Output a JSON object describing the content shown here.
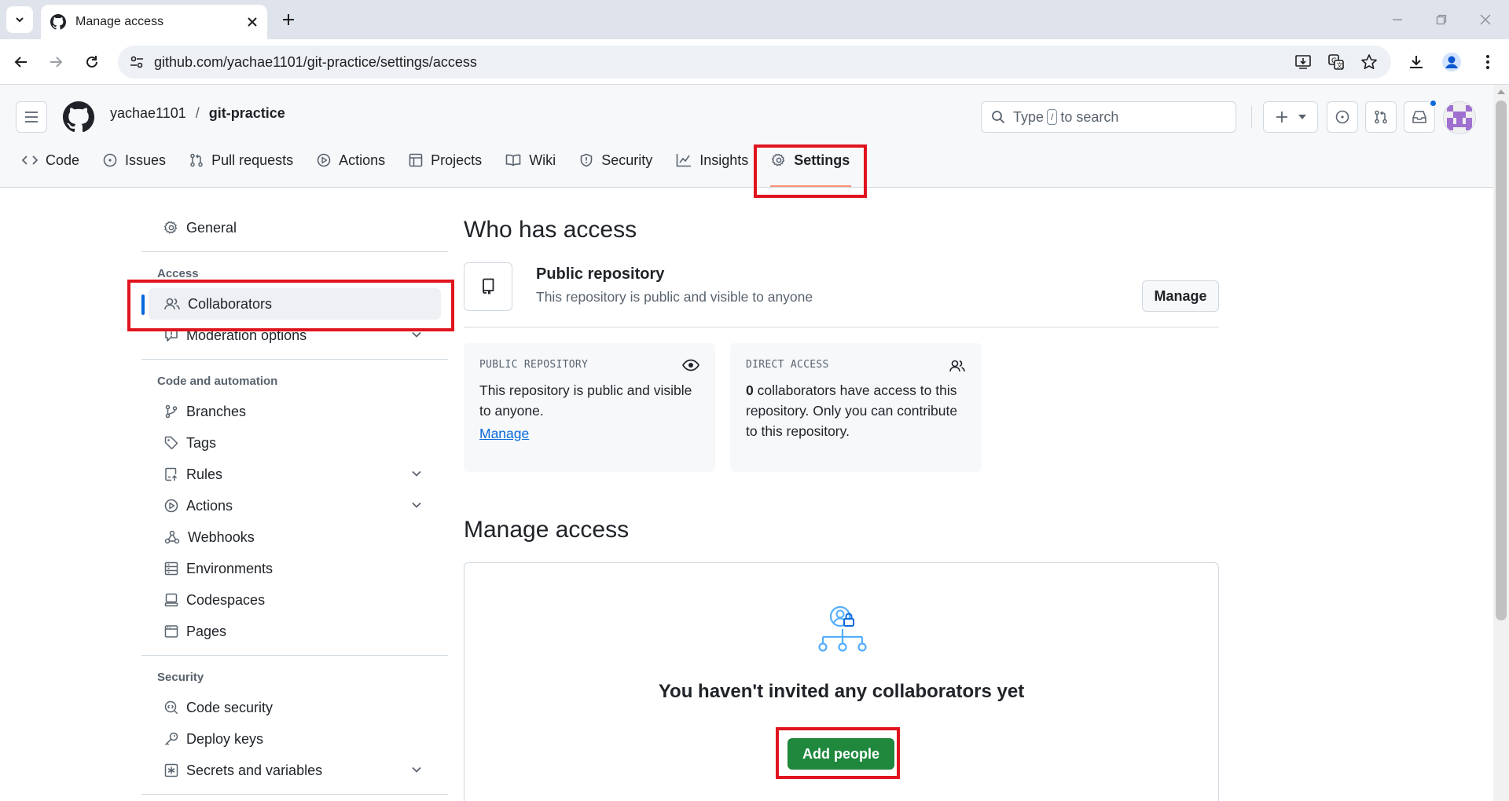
{
  "browser": {
    "tab_title": "Manage access",
    "url": "github.com/yachae1101/git-practice/settings/access"
  },
  "header": {
    "owner": "yachae1101",
    "separator": "/",
    "repo": "git-practice",
    "search_prefix": "Type",
    "search_key": "/",
    "search_suffix": "to search"
  },
  "repo_nav": [
    {
      "label": "Code",
      "icon": "code-icon"
    },
    {
      "label": "Issues",
      "icon": "issue-icon"
    },
    {
      "label": "Pull requests",
      "icon": "pull-request-icon"
    },
    {
      "label": "Actions",
      "icon": "play-icon"
    },
    {
      "label": "Projects",
      "icon": "table-icon"
    },
    {
      "label": "Wiki",
      "icon": "book-icon"
    },
    {
      "label": "Security",
      "icon": "shield-icon"
    },
    {
      "label": "Insights",
      "icon": "graph-icon"
    },
    {
      "label": "Settings",
      "icon": "gear-icon"
    }
  ],
  "sidebar": {
    "general": "General",
    "access_heading": "Access",
    "collaborators": "Collaborators",
    "moderation": "Moderation options",
    "code_heading": "Code and automation",
    "branches": "Branches",
    "tags": "Tags",
    "rules": "Rules",
    "actions": "Actions",
    "webhooks": "Webhooks",
    "environments": "Environments",
    "codespaces": "Codespaces",
    "pages": "Pages",
    "security_heading": "Security",
    "code_security": "Code security",
    "deploy_keys": "Deploy keys",
    "secrets": "Secrets and variables"
  },
  "main": {
    "who_title": "Who has access",
    "repo_type": "Public repository",
    "repo_desc": "This repository is public and visible to anyone",
    "manage_button": "Manage",
    "public_card_label": "PUBLIC REPOSITORY",
    "public_card_text": "This repository is public and visible to anyone.",
    "public_card_link": "Manage",
    "direct_card_label": "DIRECT ACCESS",
    "direct_count": "0",
    "direct_card_text": " collaborators have access to this repository. Only you can contribute to this repository.",
    "manage_title": "Manage access",
    "empty_title": "You haven't invited any collaborators yet",
    "add_people": "Add people"
  },
  "colors": {
    "primary_green": "#1f883d",
    "accent_blue": "#0969da",
    "highlight_red": "#e0141e"
  }
}
